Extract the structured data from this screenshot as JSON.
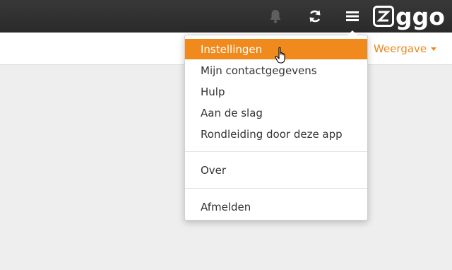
{
  "header": {
    "icons": [
      "bell-icon",
      "sync-icon",
      "menu-icon"
    ],
    "logo_text": "ggo",
    "logo_letter_in_box": "z",
    "background": "#2f2f2f"
  },
  "toolbar": {
    "view_label": "Weergave",
    "accent": "#e8891f"
  },
  "dropdown": {
    "items": [
      {
        "label": "Instellingen",
        "active": true
      },
      {
        "label": "Mijn contactgegevens",
        "active": false
      },
      {
        "label": "Hulp",
        "active": false
      },
      {
        "label": "Aan de slag",
        "active": false
      },
      {
        "label": "Rondleiding door deze app",
        "active": false
      },
      {
        "label": "Over",
        "active": false
      },
      {
        "label": "Afmelden",
        "active": false
      }
    ],
    "highlight_color": "#f08a1c"
  }
}
